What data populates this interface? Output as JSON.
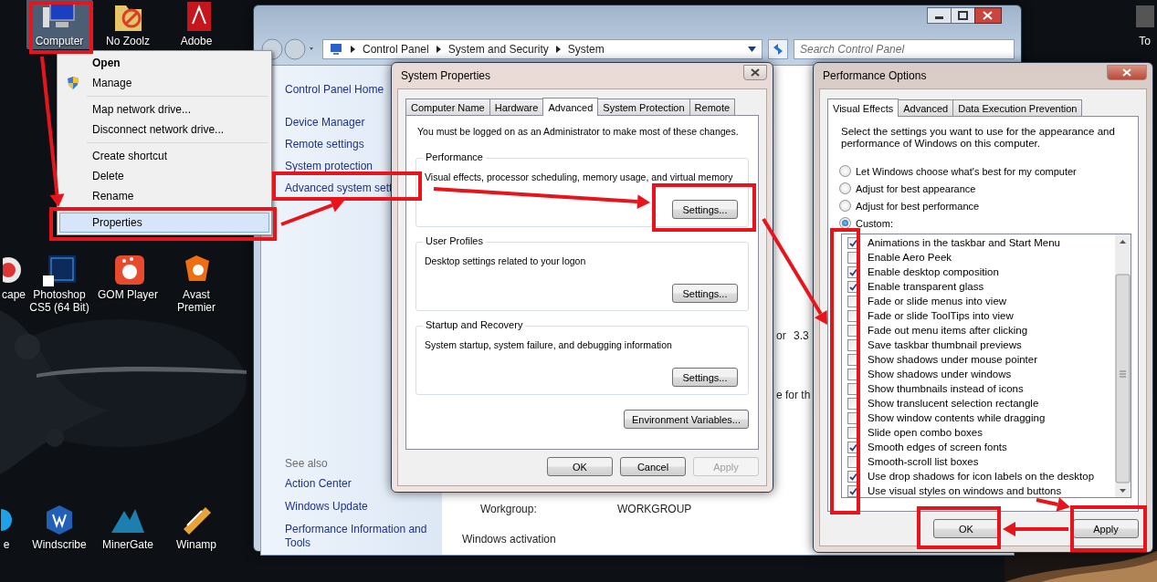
{
  "desktop": {
    "icons": [
      {
        "label": "Computer",
        "selected": true
      },
      {
        "label": "No Zoolz",
        "selected": false
      },
      {
        "label": "Adobe",
        "selected": false
      },
      {
        "label": "To",
        "selected": false
      },
      {
        "label": "cape",
        "selected": false
      },
      {
        "label": "Photoshop CS5 (64 Bit)",
        "selected": false
      },
      {
        "label": "GOM Player",
        "selected": false
      },
      {
        "label": "Avast Premier",
        "selected": false
      },
      {
        "label": "e",
        "selected": false
      },
      {
        "label": "Windscribe",
        "selected": false
      },
      {
        "label": "MinerGate",
        "selected": false
      },
      {
        "label": "Winamp",
        "selected": false
      }
    ]
  },
  "context_menu": {
    "groups": [
      [
        {
          "label": "Open",
          "kind": "default",
          "selected": false
        },
        {
          "label": "Manage",
          "kind": "admin",
          "selected": false
        }
      ],
      [
        {
          "label": "Map network drive...",
          "kind": "plain",
          "selected": false
        },
        {
          "label": "Disconnect network drive...",
          "kind": "plain",
          "selected": false
        }
      ],
      [
        {
          "label": "Create shortcut",
          "kind": "plain",
          "selected": false
        },
        {
          "label": "Delete",
          "kind": "plain",
          "selected": false
        },
        {
          "label": "Rename",
          "kind": "plain",
          "selected": false
        }
      ],
      [
        {
          "label": "Properties",
          "kind": "plain",
          "selected": true
        }
      ]
    ]
  },
  "explorer": {
    "breadcrumbs": [
      "Control Panel",
      "System and Security",
      "System"
    ],
    "search": {
      "placeholder": "Search Control Panel"
    },
    "home_link": "Control Panel Home",
    "tasks": [
      "Device Manager",
      "Remote settings",
      "System protection",
      "Advanced system sett"
    ],
    "see_also": {
      "heading": "See also",
      "links": [
        "Action Center",
        "Windows Update",
        "Performance Information and Tools"
      ]
    },
    "processor_row": [
      "or",
      "3.3"
    ],
    "rating_row": "e for th",
    "workgroup": {
      "label": "Workgroup:",
      "value": "WORKGROUP"
    },
    "section": "Windows activation"
  },
  "system_properties": {
    "title": "System Properties",
    "tabs": [
      {
        "label": "Computer Name",
        "selected": false
      },
      {
        "label": "Hardware",
        "selected": false
      },
      {
        "label": "Advanced",
        "selected": true
      },
      {
        "label": "System Protection",
        "selected": false
      },
      {
        "label": "Remote",
        "selected": false
      }
    ],
    "notice": "You must be logged on as an Administrator to make most of these changes.",
    "groups": [
      {
        "title": "Performance",
        "description": "Visual effects, processor scheduling, memory usage, and virtual memory",
        "button": "Settings..."
      },
      {
        "title": "User Profiles",
        "description": "Desktop settings related to your logon",
        "button": "Settings..."
      },
      {
        "title": "Startup and Recovery",
        "description": "System startup, system failure, and debugging information",
        "button": "Settings..."
      }
    ],
    "environment_button": "Environment Variables...",
    "buttons": [
      {
        "label": "OK",
        "disabled": false
      },
      {
        "label": "Cancel",
        "disabled": false
      },
      {
        "label": "Apply",
        "disabled": true
      }
    ]
  },
  "performance_options": {
    "title": "Performance Options",
    "tabs": [
      {
        "label": "Visual Effects",
        "selected": true
      },
      {
        "label": "Advanced",
        "selected": false
      },
      {
        "label": "Data Execution Prevention",
        "selected": false
      }
    ],
    "intro": "Select the settings you want to use for the appearance and performance of Windows on this computer.",
    "radios": [
      {
        "label": "Let Windows choose what's best for my computer",
        "selected": false
      },
      {
        "label": "Adjust for best appearance",
        "selected": false
      },
      {
        "label": "Adjust for best performance",
        "selected": false
      },
      {
        "label": "Custom:",
        "selected": true
      }
    ],
    "effects": [
      {
        "label": "Animations in the taskbar and Start Menu",
        "checked": true
      },
      {
        "label": "Enable Aero Peek",
        "checked": false
      },
      {
        "label": "Enable desktop composition",
        "checked": true
      },
      {
        "label": "Enable transparent glass",
        "checked": true
      },
      {
        "label": "Fade or slide menus into view",
        "checked": false
      },
      {
        "label": "Fade or slide ToolTips into view",
        "checked": false
      },
      {
        "label": "Fade out menu items after clicking",
        "checked": false
      },
      {
        "label": "Save taskbar thumbnail previews",
        "checked": false
      },
      {
        "label": "Show shadows under mouse pointer",
        "checked": false
      },
      {
        "label": "Show shadows under windows",
        "checked": false
      },
      {
        "label": "Show thumbnails instead of icons",
        "checked": false
      },
      {
        "label": "Show translucent selection rectangle",
        "checked": false
      },
      {
        "label": "Show window contents while dragging",
        "checked": false
      },
      {
        "label": "Slide open combo boxes",
        "checked": false
      },
      {
        "label": "Smooth edges of screen fonts",
        "checked": true
      },
      {
        "label": "Smooth-scroll list boxes",
        "checked": false
      },
      {
        "label": "Use drop shadows for icon labels on the desktop",
        "checked": true
      },
      {
        "label": "Use visual styles on windows and buttons",
        "checked": true
      }
    ],
    "buttons": [
      {
        "label": "OK",
        "disabled": false
      },
      {
        "label": "Apply",
        "disabled": false
      }
    ]
  }
}
